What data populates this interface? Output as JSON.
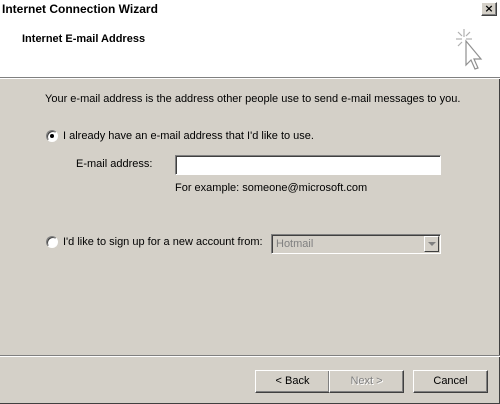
{
  "window": {
    "title": "Internet Connection Wizard",
    "close_glyph": "×"
  },
  "header": {
    "title": "Internet E-mail Address",
    "icon": "wizard-cursor-sparkle-icon"
  },
  "content": {
    "intro": "Your e-mail address is the address other people use to send e-mail messages to you.",
    "option_existing": {
      "label": "I already have an e-mail address that I'd like to use.",
      "selected": true
    },
    "email_label": "E-mail address:",
    "email_value": "",
    "example": "For example: someone@microsoft.com",
    "option_signup": {
      "label": "I'd like to sign up for a new account from:",
      "selected": false
    },
    "provider_select": {
      "value": "Hotmail",
      "enabled": false
    }
  },
  "buttons": {
    "back": "< Back",
    "next": "Next >",
    "cancel": "Cancel"
  }
}
